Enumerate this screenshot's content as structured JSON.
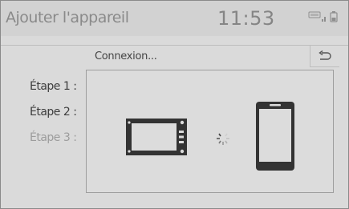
{
  "header": {
    "title": "Ajouter l'appareil",
    "clock": "11:53",
    "status_icons": [
      "dcm-icon",
      "signal-bars-icon",
      "battery-icon"
    ]
  },
  "connection": {
    "status_text": "Connexion...",
    "back_icon": "return-arrow-icon"
  },
  "steps": [
    {
      "label": "Étape 1 :",
      "state": "done"
    },
    {
      "label": "Étape 2 :",
      "state": "done"
    },
    {
      "label": "Étape 3 :",
      "state": "pending"
    }
  ],
  "diagram": {
    "left_device": "head-unit-icon",
    "middle": "loading-spinner-icon",
    "right_device": "smartphone-icon"
  },
  "colors": {
    "background": "#d6d6d6",
    "text_dark": "#3c3c3c",
    "text_disabled": "#9c9c9c",
    "icon": "#333333"
  }
}
